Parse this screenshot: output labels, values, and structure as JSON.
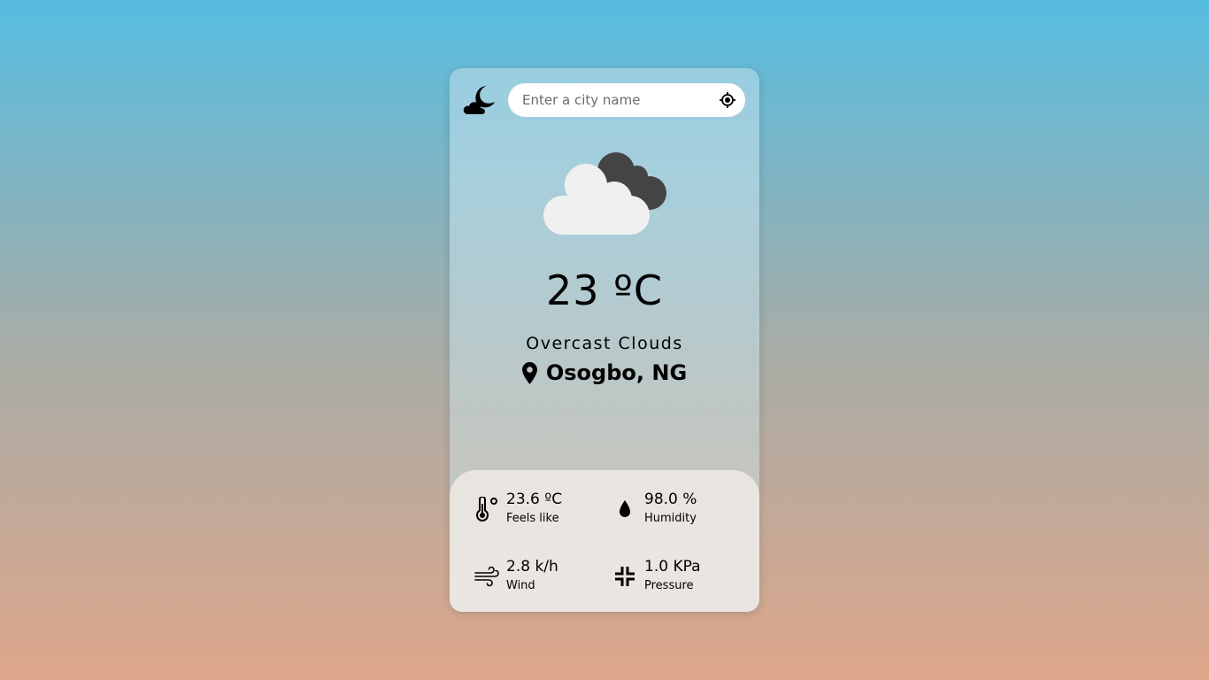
{
  "app": {
    "logo_icon": "cloud-moon-icon"
  },
  "search": {
    "placeholder": "Enter a city name",
    "value": "",
    "locate_icon": "crosshair-location-icon"
  },
  "current": {
    "icon": "overcast-clouds-icon",
    "temperature": "23 ºC",
    "description": "Overcast Clouds",
    "location_icon": "map-pin-icon",
    "location": "Osogbo, NG"
  },
  "details": [
    {
      "icon": "thermometer-icon",
      "value": "23.6 ºC",
      "label": "Feels like"
    },
    {
      "icon": "droplet-icon",
      "value": "98.0 %",
      "label": "Humidity"
    },
    {
      "icon": "wind-icon",
      "value": "2.8 k/h",
      "label": "Wind"
    },
    {
      "icon": "compress-icon",
      "value": "1.0 KPa",
      "label": "Pressure"
    }
  ],
  "colors": {
    "background_top": "#56bde1",
    "background_bottom": "#dea68a",
    "cloud_light": "#f0f0f0",
    "cloud_dark": "#444444"
  }
}
